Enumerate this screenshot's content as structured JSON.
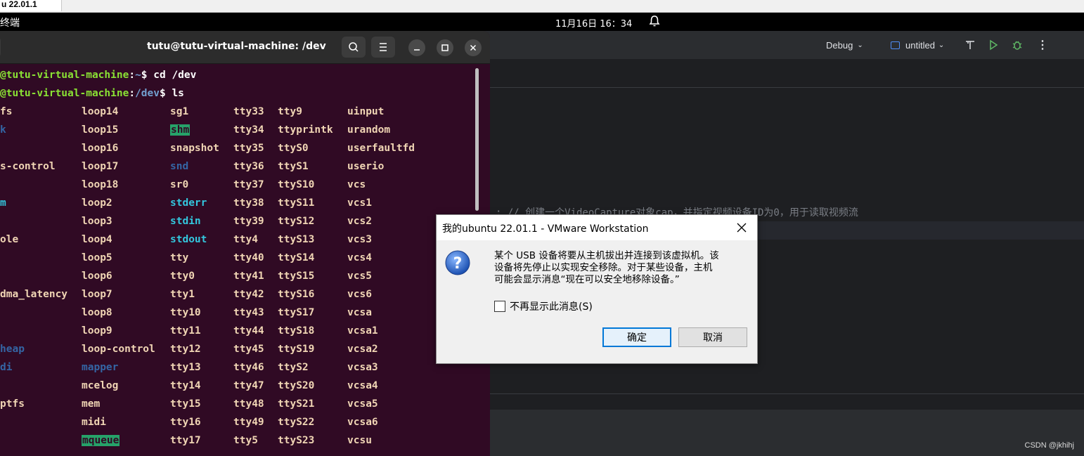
{
  "vm_tab": {
    "label": "u 22.01.1"
  },
  "topbar": {
    "activities": "终端",
    "clock": "11月16日  16：34"
  },
  "terminal": {
    "title": "tutu@tutu-virtual-machine: /dev",
    "lines": [
      {
        "user": "@tutu-virtual-machine",
        "path": "~",
        "cmd": "$ cd /dev"
      },
      {
        "user": "@tutu-virtual-machine",
        "path": "/dev",
        "cmd": "$ ls"
      }
    ],
    "columns": [
      [
        "fs",
        "k",
        "",
        "s-control",
        "",
        "m",
        "",
        "ole",
        "",
        "",
        "dma_latency",
        "",
        "",
        "heap",
        "di",
        "",
        "ptfs",
        "",
        ""
      ],
      [
        "loop14",
        "loop15",
        "loop16",
        "loop17",
        "loop18",
        "loop2",
        "loop3",
        "loop4",
        "loop5",
        "loop6",
        "loop7",
        "loop8",
        "loop9",
        "loop-control",
        "mapper",
        "mcelog",
        "mem",
        "midi",
        "mqueue"
      ],
      [
        "sg1",
        "shm",
        "snapshot",
        "snd",
        "sr0",
        "stderr",
        "stdin",
        "stdout",
        "tty",
        "tty0",
        "tty1",
        "tty10",
        "tty11",
        "tty12",
        "tty13",
        "tty14",
        "tty15",
        "tty16",
        "tty17"
      ],
      [
        "tty33",
        "tty34",
        "tty35",
        "tty36",
        "tty37",
        "tty38",
        "tty39",
        "tty4",
        "tty40",
        "tty41",
        "tty42",
        "tty43",
        "tty44",
        "tty45",
        "tty46",
        "tty47",
        "tty48",
        "tty49",
        "tty5"
      ],
      [
        "tty9",
        "ttyprintk",
        "ttyS0",
        "ttyS1",
        "ttyS10",
        "ttyS11",
        "ttyS12",
        "ttyS13",
        "ttyS14",
        "ttyS15",
        "ttyS16",
        "ttyS17",
        "ttyS18",
        "ttyS19",
        "ttyS2",
        "ttyS20",
        "ttyS21",
        "ttyS22",
        "ttyS23"
      ],
      [
        "uinput",
        "urandom",
        "userfaultfd",
        "userio",
        "vcs",
        "vcs1",
        "vcs2",
        "vcs3",
        "vcs4",
        "vcs5",
        "vcs6",
        "vcsa",
        "vcsa1",
        "vcsa2",
        "vcsa3",
        "vcsa4",
        "vcsa5",
        "vcsa6",
        "vcsu"
      ]
    ]
  },
  "ide": {
    "debug_label": "Debug",
    "config_label": "untitled",
    "comment": ";  // 创建一个VideoCapture对象cap，并指定视频设备ID为0，用于读取视频流",
    "watermark": "CSDN @jkhihj"
  },
  "dialog": {
    "title": "我的ubuntu 22.01.1 - VMware Workstation",
    "message_l1": "某个 USB 设备将要从主机拔出并连接到该虚拟机。该",
    "message_l2": "设备将先停止以实现安全移除。对于某些设备，主机",
    "message_l3": "可能会显示消息“现在可以安全地移除设备。”",
    "checkbox_label": "不再显示此消息(S)",
    "ok_label": "确定",
    "cancel_label": "取消"
  },
  "colors": {
    "terminal_bg": "#300a24",
    "dir": "#3465a4",
    "link": "#33c7de",
    "highlight": "#26a269",
    "accent": "#0078d7"
  }
}
